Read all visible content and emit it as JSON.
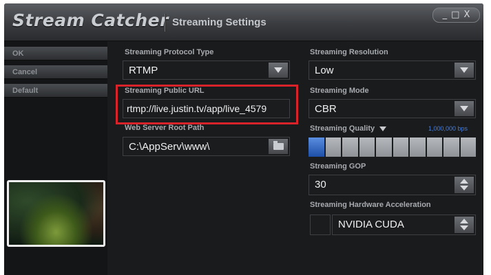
{
  "app": {
    "title": "Stream Catcher",
    "page_title": "Streaming Settings"
  },
  "window_controls": {
    "minimize": "_",
    "maximize": "□",
    "close": "X"
  },
  "sidebar": {
    "buttons": [
      "OK",
      "Cancel",
      "Default"
    ]
  },
  "settings": {
    "protocol": {
      "label": "Streaming Protocol Type",
      "value": "RTMP"
    },
    "public_url": {
      "label": "Streaming Public URL",
      "value": "rtmp://live.justin.tv/app/live_4579"
    },
    "web_root": {
      "label": "Web Server Root Path",
      "value": "C:\\AppServ\\www\\"
    },
    "resolution": {
      "label": "Streaming Resolution",
      "value": "Low"
    },
    "mode": {
      "label": "Streaming Mode",
      "value": "CBR"
    },
    "quality": {
      "label": "Streaming Quality",
      "bps": "1,000,000 bps",
      "level": 1,
      "segments": 10
    },
    "gop": {
      "label": "Streaming GOP",
      "value": "30"
    },
    "hw_accel": {
      "label": "Streaming Hardware Acceleration",
      "value": "NVIDIA CUDA"
    }
  },
  "colors": {
    "highlight": "#d9232a",
    "accent_blue": "#2a5fbf",
    "background": "#1a1b1d"
  }
}
